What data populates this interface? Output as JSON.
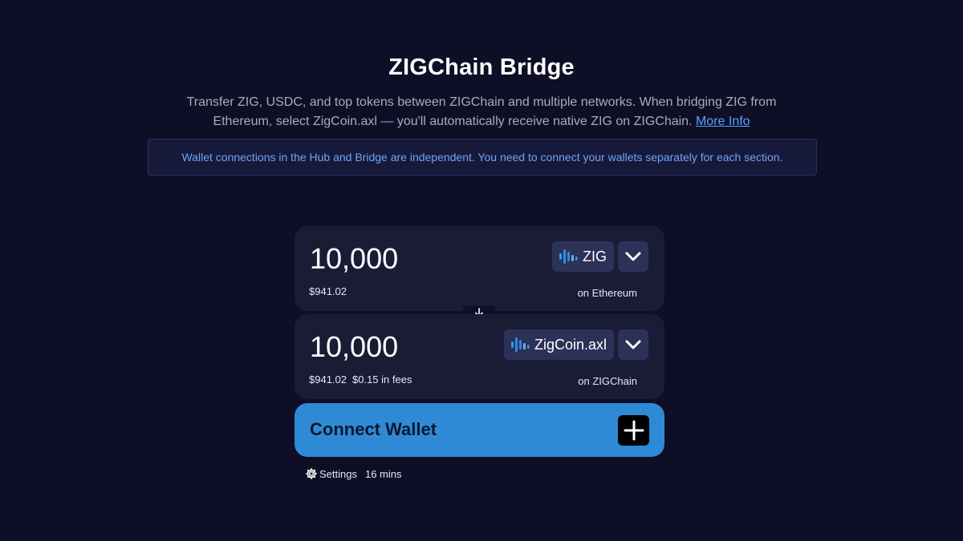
{
  "page": {
    "title": "ZIGChain Bridge",
    "subtitle_text": "Transfer ZIG, USDC, and top tokens between ZIGChain and multiple networks. When bridging ZIG from Ethereum, select ZigCoin.axl — you'll automatically receive native ZIG on ZIGChain.",
    "more_info_label": "More Info"
  },
  "notice": {
    "text": "Wallet connections in the Hub and Bridge are independent. You need to connect your wallets separately for each section."
  },
  "from": {
    "amount": "10,000",
    "usd_value": "$941.02",
    "token": "ZIG",
    "token_icon": "zig-logo-icon",
    "network": "on Ethereum"
  },
  "to": {
    "amount": "10,000",
    "usd_value": "$941.02",
    "fees": "$0.15 in fees",
    "token": "ZigCoin.axl",
    "token_icon": "zig-logo-icon",
    "network": "on ZIGChain"
  },
  "connect": {
    "label": "Connect Wallet"
  },
  "footer": {
    "settings_label": "Settings",
    "time_estimate": "16 mins"
  },
  "colors": {
    "background": "#0e0f26",
    "card": "#1a1c36",
    "accent": "#2f8ad6",
    "link": "#5aa2ff",
    "notice_text": "#6ea5f5"
  }
}
